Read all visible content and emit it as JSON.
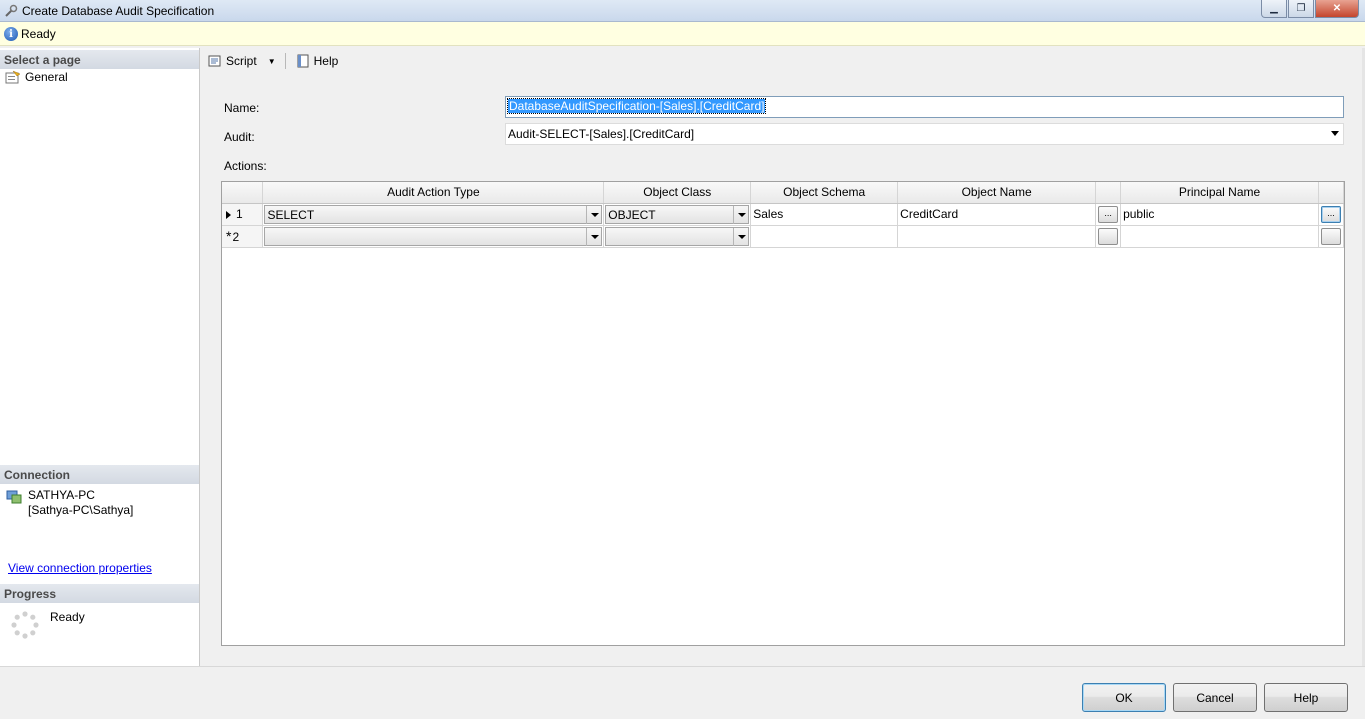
{
  "window": {
    "title": "Create Database Audit Specification"
  },
  "status": {
    "text": "Ready"
  },
  "left_panel": {
    "select_page_header": "Select a page",
    "pages": [
      {
        "label": "General"
      }
    ],
    "connection_header": "Connection",
    "connection_server": "SATHYA-PC",
    "connection_user": "[Sathya-PC\\Sathya]",
    "connection_link": "View connection properties",
    "progress_header": "Progress",
    "progress_text": "Ready"
  },
  "toolbar": {
    "script_label": "Script",
    "help_label": "Help"
  },
  "form": {
    "name_label": "Name:",
    "name_value": "DatabaseAuditSpecification-[Sales].[CreditCard]",
    "audit_label": "Audit:",
    "audit_value": "Audit-SELECT-[Sales].[CreditCard]",
    "actions_label": "Actions:"
  },
  "grid": {
    "columns": [
      "Audit Action Type",
      "Object Class",
      "Object Schema",
      "Object Name",
      "Principal Name"
    ],
    "rows": [
      {
        "num": "1",
        "action": "SELECT",
        "class": "OBJECT",
        "schema": "Sales",
        "name": "CreditCard",
        "principal": "public",
        "ellipsis": "..."
      },
      {
        "num": "2",
        "action": "",
        "class": "",
        "schema": "",
        "name": "",
        "principal": "",
        "ellipsis": ""
      }
    ],
    "new_row_marker": "*"
  },
  "buttons": {
    "ok": "OK",
    "cancel": "Cancel",
    "help": "Help"
  }
}
